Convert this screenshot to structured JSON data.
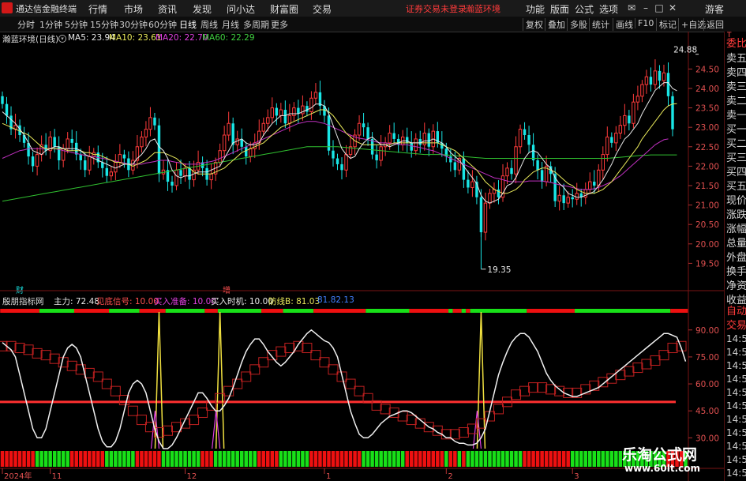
{
  "app": {
    "title": "通达信金融终端",
    "menus": [
      "行情",
      "市场",
      "资讯",
      "发现",
      "问小达",
      "财富圈",
      "交易"
    ],
    "warning_text": "证券交易未登录",
    "warning_stock": "瀚蓝环境",
    "right_menus": [
      "功能",
      "版面",
      "公式",
      "选项"
    ],
    "user": "游客",
    "colors": {
      "up": "#ff3b3b",
      "down": "#19e6e6",
      "bg": "#000000"
    }
  },
  "toolbar": {
    "periods": [
      "分时",
      "1分钟",
      "5分钟",
      "15分钟",
      "30分钟",
      "60分钟",
      "日线",
      "周线",
      "月线",
      "多周期",
      "更多"
    ],
    "active_period": "日线",
    "right_buttons": [
      "复权",
      "叠加",
      "多股",
      "统计",
      "画线",
      "F10",
      "标记",
      "+自选",
      "返回"
    ]
  },
  "sidebar": {
    "top_label": "T",
    "items": [
      "委比",
      "卖五",
      "卖四",
      "卖三",
      "卖二",
      "卖一",
      "买一",
      "买二",
      "买三",
      "买四",
      "买五",
      "现价",
      "涨跌",
      "涨幅",
      "总量",
      "外盘",
      "换手",
      "净资",
      "收益"
    ],
    "bottom": [
      "自动",
      "交易"
    ],
    "times": [
      "14:56",
      "14:56",
      "14:56",
      "14:56",
      "14:56",
      "14:56",
      "14:56",
      "14:56",
      "14:56",
      "14:56",
      "14:56"
    ]
  },
  "legend": {
    "stock": "瀚蓝环境(日线)",
    "ma5": "MA5: 23.94",
    "ma10": "MA10: 23.61",
    "ma20": "MA20: 22.70",
    "ma60": "MA60: 22.29"
  },
  "indicator": {
    "name": "殷朋指标网",
    "zhuli": "主力: 72.48",
    "xiandi": "见底信号: 10.00",
    "zhunbei": "买入准备: 10.00",
    "shiji": "买入时机: 10.00",
    "fangxian": "防线B: 81.03",
    "extra": "81.82.13"
  },
  "markers": {
    "cai": "财",
    "zeng": "增"
  },
  "watermark": {
    "line1": "乐淘公式网",
    "line2": "www.60lt.com"
  },
  "chart_data": [
    {
      "type": "candlestick",
      "title": "瀚蓝环境(日线)",
      "ylim": [
        19.0,
        25.3
      ],
      "yticks": [
        19.5,
        20.0,
        20.5,
        21.0,
        21.5,
        22.0,
        22.5,
        23.0,
        23.5,
        24.0,
        24.5
      ],
      "x_labels": [
        {
          "i": 0,
          "label": "2024年"
        },
        {
          "i": 11,
          "label": "11"
        },
        {
          "i": 42,
          "label": "12"
        },
        {
          "i": 74,
          "label": "1"
        },
        {
          "i": 102,
          "label": "2"
        },
        {
          "i": 131,
          "label": "3"
        }
      ],
      "annotations": [
        {
          "i": 160,
          "value": 24.88,
          "label": "24.88"
        },
        {
          "i": 110,
          "value": 19.35,
          "label": "19.35"
        }
      ],
      "closes": [
        23.6,
        23.3,
        22.95,
        23.05,
        22.8,
        22.6,
        22.25,
        22.0,
        22.3,
        22.55,
        22.4,
        22.75,
        22.5,
        22.15,
        22.45,
        22.7,
        22.6,
        22.3,
        22.15,
        21.9,
        22.25,
        22.35,
        22.1,
        21.95,
        21.75,
        21.85,
        22.1,
        22.3,
        22.2,
        21.9,
        22.15,
        22.5,
        22.75,
        22.95,
        23.25,
        23.05,
        21.8,
        21.9,
        21.6,
        21.5,
        21.9,
        21.75,
        21.95,
        21.65,
        21.9,
        22.1,
        21.95,
        21.65,
        21.8,
        22.1,
        22.4,
        22.8,
        23.1,
        22.55,
        22.7,
        22.5,
        22.25,
        22.45,
        22.6,
        22.9,
        23.1,
        23.25,
        23.5,
        23.3,
        23.45,
        23.1,
        23.3,
        23.5,
        23.35,
        23.55,
        23.4,
        23.75,
        23.9,
        23.55,
        23.3,
        22.4,
        22.2,
        22.05,
        21.9,
        22.3,
        22.5,
        22.8,
        23.1,
        23.0,
        22.7,
        22.3,
        22.15,
        22.5,
        22.6,
        22.85,
        22.7,
        22.55,
        22.75,
        22.6,
        22.4,
        22.7,
        22.55,
        22.85,
        22.5,
        22.9,
        22.6,
        22.45,
        22.25,
        22.1,
        21.9,
        22.2,
        21.65,
        21.45,
        21.6,
        21.2,
        20.3,
        21.05,
        21.3,
        21.4,
        21.2,
        21.75,
        21.95,
        21.8,
        22.5,
        22.95,
        22.8,
        22.55,
        22.15,
        21.9,
        21.6,
        22.0,
        21.8,
        21.1,
        21.25,
        21.05,
        21.2,
        21.15,
        21.3,
        21.2,
        21.4,
        21.6,
        21.5,
        21.9,
        22.3,
        22.75,
        22.6,
        22.85,
        23.05,
        23.3,
        23.1,
        23.65,
        23.8,
        24.1,
        24.3,
        24.1,
        24.45,
        24.2,
        24.4,
        23.8,
        22.95
      ],
      "ma5": [
        23.4,
        23.3,
        23.2,
        23.1,
        22.95,
        22.8,
        22.6,
        22.4,
        22.35,
        22.3,
        22.4,
        22.45,
        22.5,
        22.5,
        22.45,
        22.45,
        22.45,
        22.45,
        22.4,
        22.3,
        22.25,
        22.2,
        22.15,
        22.1,
        22.05,
        22.0,
        21.95,
        22.0,
        22.05,
        22.05,
        22.05,
        22.2,
        22.3,
        22.45,
        22.65,
        22.7,
        22.5,
        22.4,
        22.2,
        21.9,
        21.75,
        21.7,
        21.75,
        21.75,
        21.8,
        21.85,
        21.85,
        21.85,
        21.9,
        21.95,
        22.0,
        22.2,
        22.4,
        22.6,
        22.65,
        22.7,
        22.6,
        22.55,
        22.55,
        22.6,
        22.8,
        22.95,
        23.1,
        23.2,
        23.3,
        23.3,
        23.35,
        23.35,
        23.35,
        23.4,
        23.45,
        23.5,
        23.6,
        23.6,
        23.55,
        23.35,
        23.05,
        22.75,
        22.45,
        22.3,
        22.2,
        22.25,
        22.45,
        22.6,
        22.7,
        22.75,
        22.65,
        22.55,
        22.55,
        22.5,
        22.55,
        22.6,
        22.65,
        22.65,
        22.6,
        22.6,
        22.6,
        22.65,
        22.65,
        22.7,
        22.65,
        22.6,
        22.5,
        22.35,
        22.25,
        22.15,
        22.0,
        21.85,
        21.7,
        21.55,
        21.25,
        21.1,
        21.05,
        21.1,
        21.15,
        21.3,
        21.5,
        21.55,
        21.7,
        21.95,
        22.2,
        22.35,
        22.4,
        22.35,
        22.2,
        22.05,
        21.95,
        21.7,
        21.55,
        21.45,
        21.3,
        21.25,
        21.2,
        21.2,
        21.25,
        21.3,
        21.35,
        21.5,
        21.65,
        21.85,
        22.05,
        22.3,
        22.5,
        22.7,
        22.8,
        22.95,
        23.1,
        23.35,
        23.55,
        23.75,
        23.95,
        24.05,
        24.15,
        24.15,
        24.0,
        23.94
      ],
      "ma10": [
        23.1,
        23.05,
        23.0,
        22.95,
        22.9,
        22.85,
        22.8,
        22.7,
        22.6,
        22.5,
        22.45,
        22.45,
        22.45,
        22.45,
        22.45,
        22.4,
        22.4,
        22.4,
        22.4,
        22.35,
        22.35,
        22.3,
        22.3,
        22.25,
        22.2,
        22.15,
        22.1,
        22.1,
        22.05,
        22.05,
        22.0,
        22.05,
        22.1,
        22.15,
        22.25,
        22.35,
        22.35,
        22.35,
        22.3,
        22.25,
        22.2,
        22.1,
        22.0,
        21.95,
        21.85,
        21.8,
        21.8,
        21.8,
        21.8,
        21.85,
        21.9,
        21.95,
        22.05,
        22.15,
        22.25,
        22.35,
        22.4,
        22.45,
        22.5,
        22.55,
        22.6,
        22.7,
        22.8,
        22.9,
        23.0,
        23.05,
        23.1,
        23.15,
        23.2,
        23.25,
        23.3,
        23.35,
        23.4,
        23.45,
        23.45,
        23.4,
        23.3,
        23.15,
        23.0,
        22.85,
        22.75,
        22.65,
        22.6,
        22.55,
        22.55,
        22.55,
        22.55,
        22.55,
        22.55,
        22.55,
        22.6,
        22.6,
        22.6,
        22.6,
        22.6,
        22.6,
        22.6,
        22.6,
        22.6,
        22.6,
        22.6,
        22.55,
        22.5,
        22.45,
        22.4,
        22.3,
        22.2,
        22.1,
        22.0,
        21.9,
        21.75,
        21.6,
        21.5,
        21.4,
        21.35,
        21.3,
        21.3,
        21.35,
        21.4,
        21.5,
        21.65,
        21.75,
        21.85,
        21.9,
        21.95,
        21.95,
        21.9,
        21.85,
        21.75,
        21.65,
        21.55,
        21.5,
        21.4,
        21.35,
        21.3,
        21.3,
        21.3,
        21.35,
        21.4,
        21.5,
        21.6,
        21.75,
        21.9,
        22.05,
        22.2,
        22.35,
        22.5,
        22.7,
        22.85,
        23.0,
        23.15,
        23.3,
        23.45,
        23.55,
        23.6,
        23.61
      ],
      "ma20": [
        22.2,
        22.25,
        22.3,
        22.35,
        22.4,
        22.42,
        22.45,
        22.45,
        22.45,
        22.45,
        22.45,
        22.45,
        22.45,
        22.43,
        22.4,
        22.38,
        22.35,
        22.33,
        22.3,
        22.28,
        22.25,
        22.25,
        22.22,
        22.2,
        22.18,
        22.15,
        22.13,
        22.1,
        22.08,
        22.05,
        22.05,
        22.05,
        22.05,
        22.08,
        22.1,
        22.12,
        22.15,
        22.15,
        22.15,
        22.12,
        22.1,
        22.08,
        22.05,
        22.05,
        22.05,
        22.05,
        22.08,
        22.1,
        22.12,
        22.15,
        22.2,
        22.25,
        22.3,
        22.35,
        22.4,
        22.45,
        22.5,
        22.55,
        22.6,
        22.65,
        22.7,
        22.75,
        22.8,
        22.85,
        22.9,
        22.95,
        23.0,
        23.05,
        23.1,
        23.12,
        23.15,
        23.15,
        23.15,
        23.12,
        23.1,
        23.05,
        23.0,
        22.95,
        22.9,
        22.85,
        22.8,
        22.75,
        22.72,
        22.7,
        22.68,
        22.65,
        22.62,
        22.6,
        22.6,
        22.58,
        22.58,
        22.56,
        22.55,
        22.55,
        22.52,
        22.5,
        22.48,
        22.45,
        22.42,
        22.4,
        22.35,
        22.3,
        22.25,
        22.2,
        22.15,
        22.1,
        22.05,
        22.0,
        21.95,
        21.9,
        21.85,
        21.8,
        21.75,
        21.7,
        21.68,
        21.65,
        21.62,
        21.6,
        21.6,
        21.6,
        21.6,
        21.62,
        21.62,
        21.62,
        21.62,
        21.6,
        21.58,
        21.55,
        21.52,
        21.5,
        21.48,
        21.45,
        21.42,
        21.4,
        21.4,
        21.4,
        21.42,
        21.45,
        21.5,
        21.55,
        21.6,
        21.68,
        21.75,
        21.85,
        21.95,
        22.05,
        22.15,
        22.25,
        22.35,
        22.45,
        22.55,
        22.62,
        22.68,
        22.7
      ],
      "ma60": [
        21.1,
        21.12,
        21.14,
        21.16,
        21.18,
        21.2,
        21.22,
        21.24,
        21.26,
        21.28,
        21.3,
        21.32,
        21.34,
        21.36,
        21.38,
        21.4,
        21.42,
        21.44,
        21.46,
        21.48,
        21.5,
        21.52,
        21.54,
        21.56,
        21.58,
        21.6,
        21.62,
        21.64,
        21.66,
        21.68,
        21.7,
        21.72,
        21.74,
        21.76,
        21.78,
        21.8,
        21.82,
        21.84,
        21.86,
        21.88,
        21.9,
        21.92,
        21.94,
        21.96,
        21.98,
        22.0,
        22.02,
        22.04,
        22.06,
        22.08,
        22.1,
        22.12,
        22.14,
        22.16,
        22.18,
        22.2,
        22.22,
        22.24,
        22.26,
        22.28,
        22.3,
        22.32,
        22.34,
        22.36,
        22.38,
        22.4,
        22.42,
        22.44,
        22.46,
        22.48,
        22.5,
        22.5,
        22.5,
        22.5,
        22.5,
        22.5,
        22.5,
        22.5,
        22.49,
        22.48,
        22.47,
        22.46,
        22.45,
        22.44,
        22.43,
        22.42,
        22.41,
        22.4,
        22.39,
        22.38,
        22.37,
        22.36,
        22.35,
        22.34,
        22.33,
        22.32,
        22.31,
        22.3,
        22.3,
        22.3,
        22.3,
        22.3,
        22.29,
        22.28,
        22.27,
        22.26,
        22.25,
        22.24,
        22.23,
        22.22,
        22.21,
        22.2,
        22.2,
        22.2,
        22.2,
        22.2,
        22.2,
        22.2,
        22.2,
        22.2,
        22.2,
        22.2,
        22.2,
        22.2,
        22.2,
        22.2,
        22.2,
        22.2,
        22.2,
        22.2,
        22.2,
        22.2,
        22.2,
        22.2,
        22.2,
        22.2,
        22.2,
        22.2,
        22.2,
        22.2,
        22.21,
        22.22,
        22.23,
        22.24,
        22.25,
        22.26,
        22.27,
        22.28,
        22.28,
        22.29,
        22.29,
        22.29,
        22.29,
        22.29,
        22.29,
        22.29
      ]
    },
    {
      "type": "line",
      "title": "殷朋指标网",
      "ylim": [
        24,
        100
      ],
      "yticks": [
        30.0,
        45.0,
        60.0,
        75.0,
        90.0
      ],
      "threshold": 50,
      "series": [
        {
          "name": "主力",
          "values": [
            83,
            81,
            79,
            75,
            65,
            55,
            45,
            35,
            30,
            30,
            35,
            45,
            55,
            65,
            75,
            80,
            82,
            80,
            75,
            65,
            55,
            45,
            35,
            28,
            25,
            25,
            28,
            35,
            45,
            55,
            60,
            62,
            60,
            55,
            45,
            35,
            28,
            24,
            24,
            26,
            30,
            35,
            40,
            45,
            50,
            55,
            55,
            52,
            48,
            45,
            45,
            48,
            52,
            58,
            65,
            72,
            78,
            82,
            85,
            85,
            82,
            78,
            75,
            72,
            70,
            72,
            75,
            78,
            82,
            85,
            88,
            90,
            88,
            86,
            84,
            83,
            80,
            75,
            65,
            55,
            45,
            38,
            32,
            30,
            30,
            32,
            35,
            38,
            40,
            42,
            43,
            44,
            45,
            45,
            44,
            42,
            40,
            38,
            36,
            35,
            33,
            32,
            30,
            30,
            28,
            27,
            27,
            26,
            26,
            27,
            30,
            35,
            45,
            55,
            65,
            72,
            78,
            83,
            86,
            88,
            88,
            86,
            82,
            78,
            72,
            66,
            62,
            59,
            57,
            55,
            54,
            53,
            53,
            54,
            55,
            56,
            57,
            58,
            60,
            62,
            64,
            66,
            68,
            70,
            72,
            74,
            76,
            78,
            80,
            82,
            84,
            86,
            88,
            88,
            87,
            86,
            80,
            72.48
          ]
        },
        {
          "name": "防线B",
          "values": [
            81,
            81,
            81,
            80,
            80,
            79,
            79,
            78,
            77,
            77,
            76,
            75,
            74,
            73,
            72,
            71,
            70,
            69,
            68,
            67,
            66,
            65,
            64,
            62,
            60,
            58,
            56,
            54,
            51,
            48,
            45,
            42,
            40,
            38,
            36,
            34,
            33,
            33,
            34,
            35,
            36,
            37,
            38,
            39,
            40,
            42,
            44,
            46,
            48,
            50,
            52,
            54,
            56,
            58,
            60,
            62,
            64,
            66,
            68,
            70,
            72,
            74,
            76,
            78,
            78,
            79,
            80,
            80,
            81,
            81,
            80,
            78,
            76,
            74,
            72,
            70,
            68,
            66,
            64,
            62,
            60,
            58,
            56,
            54,
            52,
            50,
            48,
            47,
            46,
            45,
            44,
            43,
            42,
            41,
            40,
            39,
            38,
            37,
            36,
            35,
            34,
            33,
            32,
            32,
            32,
            32,
            33,
            34,
            35,
            36,
            38,
            40,
            42,
            44,
            46,
            48,
            50,
            52,
            54,
            55,
            56,
            57,
            58,
            58,
            58,
            58,
            57,
            57,
            56,
            56,
            55,
            55,
            55,
            56,
            57,
            58,
            59,
            60,
            61,
            62,
            63,
            64,
            65,
            66,
            67,
            68,
            69,
            70,
            71,
            72,
            73,
            74,
            76,
            78,
            80,
            81,
            81,
            81.03
          ]
        }
      ],
      "spikes": [
        {
          "i": 36,
          "value": 100
        },
        {
          "i": 50,
          "value": 100
        },
        {
          "i": 110,
          "value": 100
        }
      ]
    }
  ]
}
